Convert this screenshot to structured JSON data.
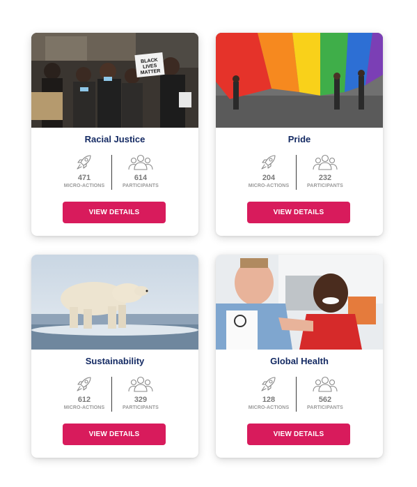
{
  "stat_labels": {
    "micro_actions": "MICRO-ACTIONS",
    "participants": "PARTICIPANTS"
  },
  "button_label": "VIEW DETAILS",
  "brand_colors": {
    "title": "#142a63",
    "button": "#d81b5c",
    "stat_text": "#7a7a7a"
  },
  "cards": [
    {
      "title": "Racial Justice",
      "image": "protest-photo",
      "image_sign_text": "BLACK LIVES MATTER",
      "micro_actions": "471",
      "participants": "614"
    },
    {
      "title": "Pride",
      "image": "rainbow-flag-photo",
      "micro_actions": "204",
      "participants": "232"
    },
    {
      "title": "Sustainability",
      "image": "polar-bear-photo",
      "micro_actions": "612",
      "participants": "329"
    },
    {
      "title": "Global Health",
      "image": "doctor-child-photo",
      "micro_actions": "128",
      "participants": "562"
    }
  ]
}
